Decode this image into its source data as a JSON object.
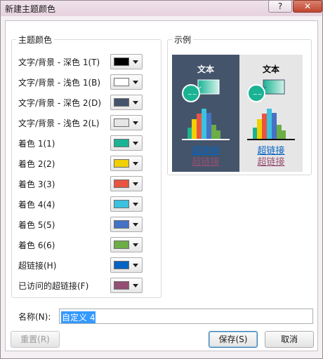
{
  "window": {
    "title": "新建主题颜色",
    "help": "?",
    "close": "✕"
  },
  "theme_colors": {
    "legend": "主题颜色",
    "rows": [
      {
        "label": "文字/背景 - 深色 1(T)",
        "color": "#000000"
      },
      {
        "label": "文字/背景 - 浅色 1(B)",
        "color": "#ffffff"
      },
      {
        "label": "文字/背景 - 深色 2(D)",
        "color": "#44546a"
      },
      {
        "label": "文字/背景 - 浅色 2(L)",
        "color": "#e7e6e6"
      },
      {
        "label": "着色 1(1)",
        "color": "#1ab394"
      },
      {
        "label": "着色 2(2)",
        "color": "#f0d000"
      },
      {
        "label": "着色 3(3)",
        "color": "#e8543f"
      },
      {
        "label": "着色 4(4)",
        "color": "#3cc1df"
      },
      {
        "label": "着色 5(5)",
        "color": "#4472c4"
      },
      {
        "label": "着色 6(6)",
        "color": "#6cad46"
      },
      {
        "label": "超链接(H)",
        "color": "#0563c1"
      },
      {
        "label": "已访问的超链接(F)",
        "color": "#954f72"
      }
    ]
  },
  "sample": {
    "legend": "示例",
    "text": "文本",
    "hyperlink": "超链接",
    "visited_hyperlink": "超链接",
    "dark_bg": "#44546a",
    "light_bg": "#e7e6e6"
  },
  "name_field": {
    "label": "名称(N):",
    "value": "自定义 4"
  },
  "buttons": {
    "reset": "重置(R)",
    "save": "保存(S)",
    "cancel": "取消"
  }
}
